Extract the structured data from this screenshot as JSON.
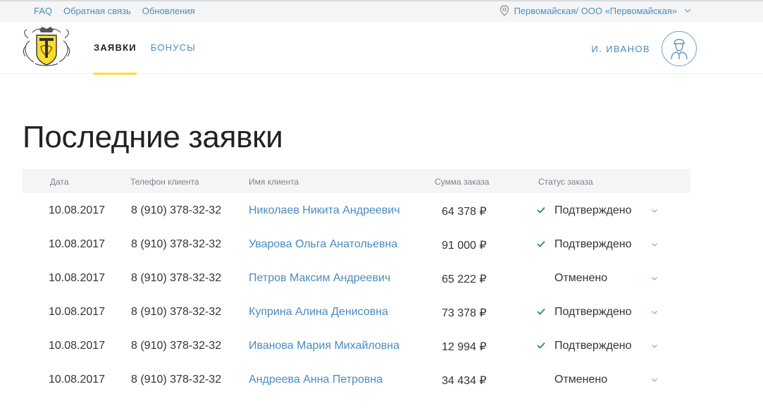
{
  "topbar": {
    "links": [
      "FAQ",
      "Обратная связь",
      "Обновления"
    ],
    "organization": "Первомайская/ ООО «Первомайская»",
    "location_icon": "location-pin-icon",
    "dropdown_icon": "chevron-down-icon"
  },
  "header": {
    "logo_icon": "bank-emblem-logo",
    "tabs": [
      {
        "label": "ЗАЯВКИ",
        "active": true
      },
      {
        "label": "БОНУСЫ",
        "active": false
      }
    ],
    "user_name": "И. ИВАНОВ",
    "avatar_icon": "user-avatar-icon"
  },
  "page": {
    "title": "Последние заявки"
  },
  "table": {
    "columns": [
      "Дата",
      "Телефон клиента",
      "Имя клиента",
      "Сумма заказа",
      "Статус заказа"
    ],
    "rows": [
      {
        "date": "10.08.2017",
        "phone": "8 (910) 378-32-32",
        "name": "Николаев Никита Андреевич",
        "sum": "64 378 ₽",
        "status": "Подтверждено",
        "confirmed": true
      },
      {
        "date": "10.08.2017",
        "phone": "8 (910) 378-32-32",
        "name": "Уварова Ольга Анатольевна",
        "sum": "91 000 ₽",
        "status": "Подтверждено",
        "confirmed": true
      },
      {
        "date": "10.08.2017",
        "phone": "8 (910) 378-32-32",
        "name": "Петров Максим Андреевич",
        "sum": "65 222 ₽",
        "status": "Отменено",
        "confirmed": false
      },
      {
        "date": "10.08.2017",
        "phone": "8 (910) 378-32-32",
        "name": "Куприна Алина Денисовна",
        "sum": "73 378 ₽",
        "status": "Подтверждено",
        "confirmed": true
      },
      {
        "date": "10.08.2017",
        "phone": "8 (910) 378-32-32",
        "name": "Иванова Мария Михайловна",
        "sum": "12 994 ₽",
        "status": "Подтверждено",
        "confirmed": true
      },
      {
        "date": "10.08.2017",
        "phone": "8 (910) 378-32-32",
        "name": "Андреева Анна Петровна",
        "sum": "34 434 ₽",
        "status": "Отменено",
        "confirmed": false
      }
    ]
  },
  "colors": {
    "accent_yellow": "#ffdd2d",
    "link_blue": "#4b8bbf",
    "check_green": "#1f8f5a",
    "header_gray": "#f4f5f7"
  }
}
